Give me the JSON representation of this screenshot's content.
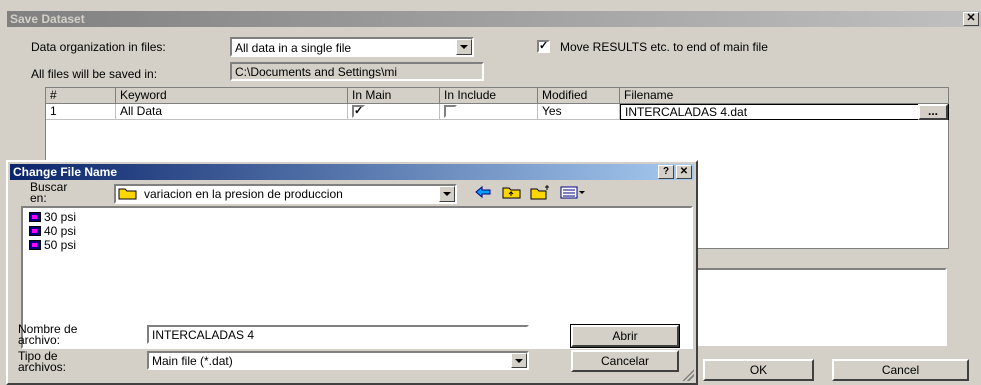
{
  "save_dialog": {
    "title": "Save Dataset",
    "close_glyph": "✕",
    "data_org_label": "Data organization in files:",
    "data_org_value": "All data in a single file",
    "move_results_label": "Move RESULTS etc. to end of main file",
    "move_results_checked": true,
    "saved_in_label": "All files will be saved in:",
    "saved_in_value": "C:\\Documents and Settings\\mi",
    "grid": {
      "headers": [
        "#",
        "Keyword",
        "In Main",
        "In Include",
        "Modified",
        "Filename"
      ],
      "rows": [
        {
          "num": "1",
          "keyword": "All Data",
          "in_main": true,
          "in_include": false,
          "modified": "Yes",
          "filename": "INTERCALADAS 4.dat",
          "browse": "..."
        }
      ]
    },
    "ok_label": "OK",
    "cancel_label": "Cancel"
  },
  "change_dialog": {
    "title": "Change File Name",
    "help_glyph": "?",
    "close_glyph": "✕",
    "lookin_label": "Buscar en:",
    "lookin_value": "variacion en la presion de produccion",
    "toolbar_icons": [
      "back-arrow-icon",
      "up-folder-icon",
      "new-folder-icon",
      "view-menu-icon"
    ],
    "files": [
      "30 psi",
      "40 psi",
      "50 psi"
    ],
    "filename_label": "Nombre de archivo:",
    "filename_value": "INTERCALADAS 4",
    "filetype_label": "Tipo de archivos:",
    "filetype_value": "Main file (*.dat)",
    "open_label": "Abrir",
    "cancel_label": "Cancelar"
  },
  "colors": {
    "window_bg": "#d4d0c8",
    "inactive_title": "#808080",
    "active_title": "#0a246a"
  }
}
